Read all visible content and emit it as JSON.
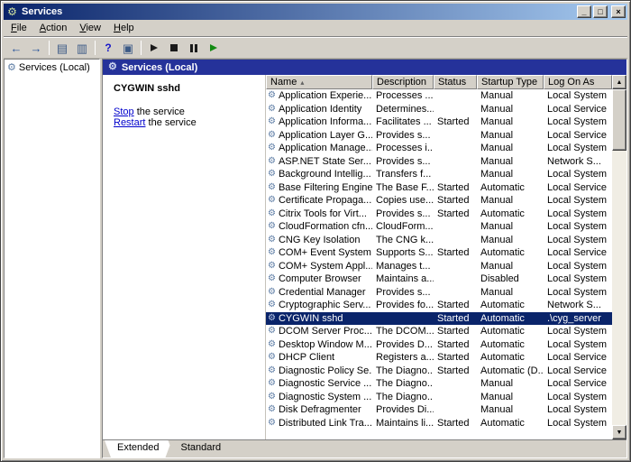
{
  "window": {
    "title": "Services",
    "icons": {
      "minimize": "_",
      "maximize": "□",
      "close": "×"
    }
  },
  "menu": {
    "items": [
      "File",
      "Action",
      "View",
      "Help"
    ]
  },
  "toolbar": {
    "icons": [
      "back",
      "forward",
      "|",
      "show-console-tree",
      "export-list",
      "|",
      "help",
      "properties",
      "|",
      "start-service",
      "stop-service",
      "pause-service",
      "restart-service"
    ]
  },
  "tree": {
    "root_label": "Services (Local)"
  },
  "detail_pane": {
    "header": "Services (Local)",
    "service_name": "CYGWIN sshd",
    "links": [
      {
        "link": "Stop",
        "rest": " the service"
      },
      {
        "link": "Restart",
        "rest": " the service"
      }
    ]
  },
  "table": {
    "columns": [
      "Name",
      "Description",
      "Status",
      "Startup Type",
      "Log On As"
    ],
    "selected_index": 17,
    "rows": [
      [
        "Application Experie...",
        "Processes ...",
        "",
        "Manual",
        "Local System"
      ],
      [
        "Application Identity",
        "Determines...",
        "",
        "Manual",
        "Local Service"
      ],
      [
        "Application Informa...",
        "Facilitates ...",
        "Started",
        "Manual",
        "Local System"
      ],
      [
        "Application Layer G...",
        "Provides s...",
        "",
        "Manual",
        "Local Service"
      ],
      [
        "Application Manage...",
        "Processes i...",
        "",
        "Manual",
        "Local System"
      ],
      [
        "ASP.NET State Ser...",
        "Provides s...",
        "",
        "Manual",
        "Network S..."
      ],
      [
        "Background Intellig...",
        "Transfers f...",
        "",
        "Manual",
        "Local System"
      ],
      [
        "Base Filtering Engine",
        "The Base F...",
        "Started",
        "Automatic",
        "Local Service"
      ],
      [
        "Certificate Propaga...",
        "Copies use...",
        "Started",
        "Manual",
        "Local System"
      ],
      [
        "Citrix Tools for Virt...",
        "Provides s...",
        "Started",
        "Automatic",
        "Local System"
      ],
      [
        "CloudFormation cfn...",
        "CloudForm...",
        "",
        "Manual",
        "Local System"
      ],
      [
        "CNG Key Isolation",
        "The CNG k...",
        "",
        "Manual",
        "Local System"
      ],
      [
        "COM+ Event System",
        "Supports S...",
        "Started",
        "Automatic",
        "Local Service"
      ],
      [
        "COM+ System Appl...",
        "Manages t...",
        "",
        "Manual",
        "Local System"
      ],
      [
        "Computer Browser",
        "Maintains a...",
        "",
        "Disabled",
        "Local System"
      ],
      [
        "Credential Manager",
        "Provides s...",
        "",
        "Manual",
        "Local System"
      ],
      [
        "Cryptographic Serv...",
        "Provides fo...",
        "Started",
        "Automatic",
        "Network S..."
      ],
      [
        "CYGWIN sshd",
        "",
        "Started",
        "Automatic",
        ".\\cyg_server"
      ],
      [
        "DCOM Server Proc...",
        "The DCOM...",
        "Started",
        "Automatic",
        "Local System"
      ],
      [
        "Desktop Window M...",
        "Provides D...",
        "Started",
        "Automatic",
        "Local System"
      ],
      [
        "DHCP Client",
        "Registers a...",
        "Started",
        "Automatic",
        "Local Service"
      ],
      [
        "Diagnostic Policy Se...",
        "The Diagno...",
        "Started",
        "Automatic (D...",
        "Local Service"
      ],
      [
        "Diagnostic Service ...",
        "The Diagno...",
        "",
        "Manual",
        "Local Service"
      ],
      [
        "Diagnostic System ...",
        "The Diagno...",
        "",
        "Manual",
        "Local System"
      ],
      [
        "Disk Defragmenter",
        "Provides Di...",
        "",
        "Manual",
        "Local System"
      ],
      [
        "Distributed Link Tra...",
        "Maintains li...",
        "Started",
        "Automatic",
        "Local System"
      ]
    ]
  },
  "tabs": [
    {
      "label": "Extended",
      "active": true
    },
    {
      "label": "Standard",
      "active": false
    }
  ],
  "colors": {
    "face": "#d4d0c8",
    "titlebar_start": "#0a246a",
    "titlebar_end": "#a6caf0",
    "result_header": "#25329a",
    "selection": "#0a246a",
    "link": "#0000cc"
  }
}
